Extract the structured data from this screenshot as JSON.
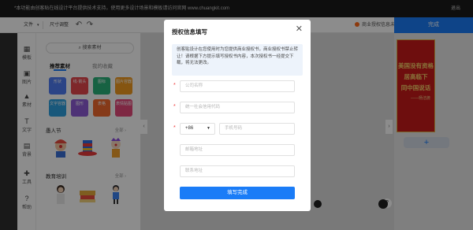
{
  "notice": {
    "text": "*本功能由创客贴在线设计平台提供技术支持，使用更多设计场景和模板请访问官网 www.chuangkit.com",
    "exit": "退出"
  },
  "toolbar": {
    "file": "文件",
    "size": "尺寸调整",
    "license_text": "商业授权信息未填写",
    "done": "完成"
  },
  "rail": {
    "items": [
      {
        "label": "模板",
        "icon": "grid-icon"
      },
      {
        "label": "图片",
        "icon": "image-icon"
      },
      {
        "label": "素材",
        "icon": "shapes-icon"
      },
      {
        "label": "文字",
        "icon": "text-icon"
      },
      {
        "label": "背景",
        "icon": "background-icon"
      },
      {
        "label": "工具",
        "icon": "toolbox-icon"
      },
      {
        "label": "帮助",
        "icon": "help-icon"
      }
    ]
  },
  "panel": {
    "search": "搜索素材",
    "tabs": [
      "推荐素材",
      "我的收藏"
    ],
    "tiles": [
      {
        "label": "形状",
        "color": "#4f7df5"
      },
      {
        "label": "线·箭头",
        "color": "#e6484e"
      },
      {
        "label": "图标",
        "color": "#2ab27b"
      },
      {
        "label": "图片容器",
        "color": "#f29b1f"
      },
      {
        "label": "文字容器",
        "color": "#2fa0e0"
      },
      {
        "label": "图形",
        "color": "#8e5bd8"
      },
      {
        "label": "表格",
        "color": "#f26a2e"
      },
      {
        "label": "表情贴图",
        "color": "#e64a7b"
      }
    ],
    "section1": "愚人节",
    "section2": "教育培训",
    "more": "全部 ›"
  },
  "poster": {
    "lines": [
      "美国没有资格",
      "居高临下",
      "同中国说话"
    ],
    "author": "——杨洁篪"
  },
  "modal": {
    "title": "授权信息填写",
    "info": "创客贴设计在您使用时为您提供商业授权书，商业授权书禁止转让！请根据下方提示填写授权书内容，本次授权书一经提交下载，将无法更改。",
    "company_placeholder": "公司名称",
    "credit_placeholder": "统一社会信用代码",
    "country_code": "+86",
    "phone_placeholder": "手机号码",
    "email_placeholder": "邮箱地址",
    "address_placeholder": "联系地址",
    "submit": "填写完成"
  },
  "colors": {
    "accent": "#1a7cf7",
    "required_star": "#e33333",
    "poster_red": "#c81b1b",
    "license_dot": "#ff6b1a"
  }
}
